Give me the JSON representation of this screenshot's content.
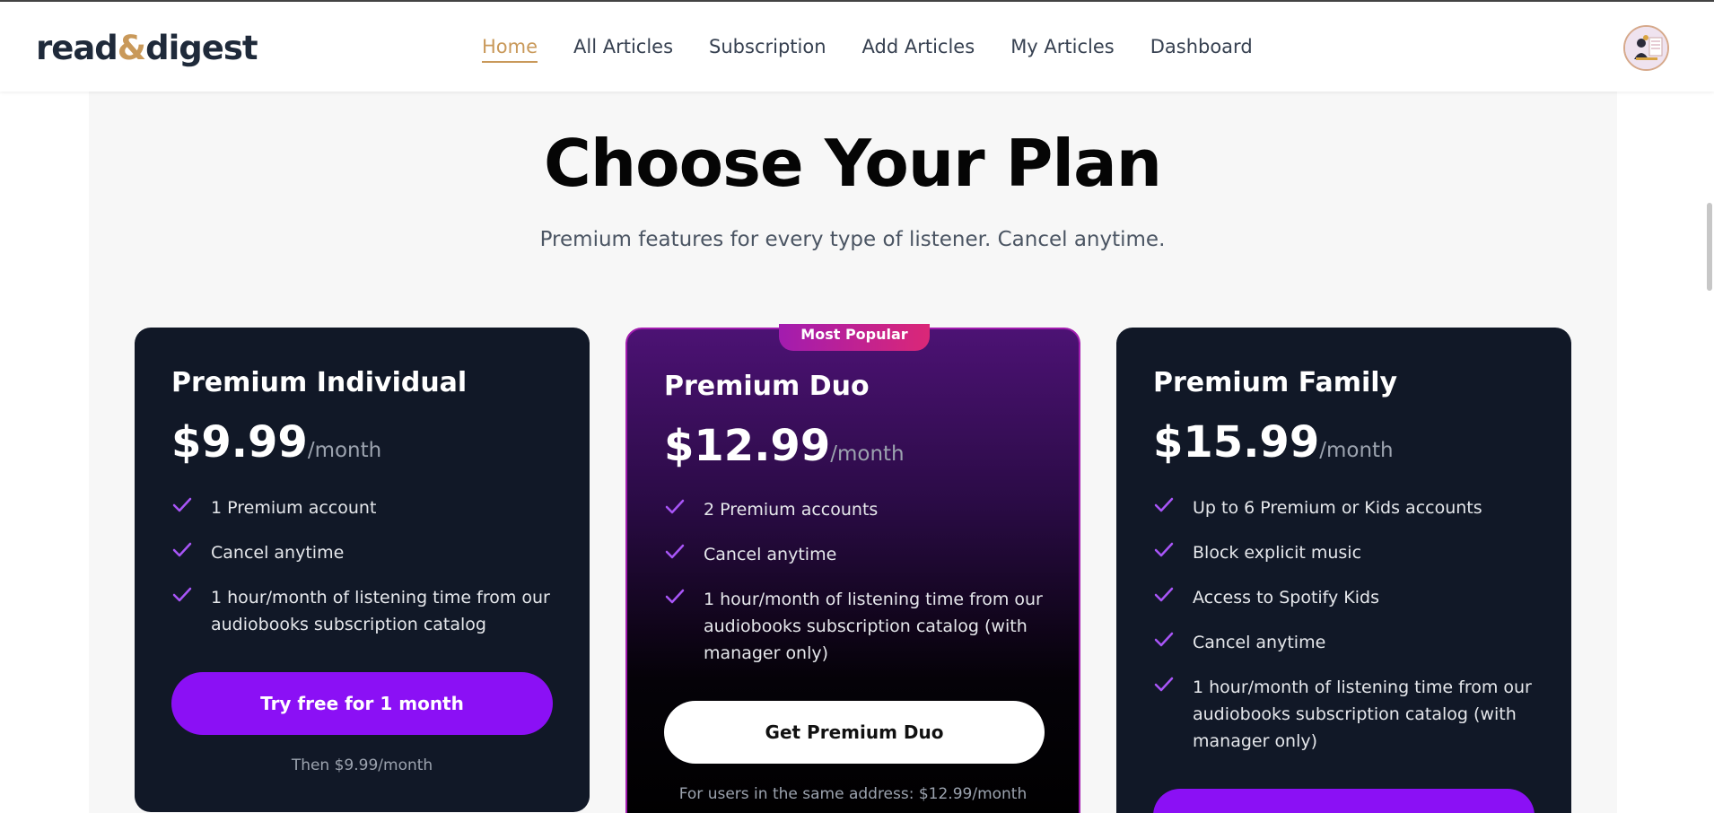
{
  "nav": {
    "logo_prefix": "read",
    "logo_amp": "&",
    "logo_suffix": "digest",
    "links": [
      "Home",
      "All Articles",
      "Subscription",
      "Add Articles",
      "My Articles",
      "Dashboard"
    ],
    "active": "Home"
  },
  "hero": {
    "title": "Choose Your Plan",
    "subtitle": "Premium features for every type of listener. Cancel anytime."
  },
  "plans": [
    {
      "name": "Premium Individual",
      "price": "$9.99",
      "period": "/month",
      "features": [
        "1 Premium account",
        "Cancel anytime",
        "1 hour/month of listening time from our audiobooks subscription catalog"
      ],
      "button": "Try free for 1 month",
      "note": "Then $9.99/month"
    },
    {
      "badge": "Most Popular",
      "name": "Premium Duo",
      "price": "$12.99",
      "period": "/month",
      "features": [
        "2 Premium accounts",
        "Cancel anytime",
        "1 hour/month of listening time from our audiobooks subscription catalog (with manager only)"
      ],
      "button": "Get Premium Duo",
      "note": "For users in the same address: $12.99/month"
    },
    {
      "name": "Premium Family",
      "price": "$15.99",
      "period": "/month",
      "features": [
        "Up to 6 Premium or Kids accounts",
        "Block explicit music",
        "Access to Spotify Kids",
        "Cancel anytime",
        "1 hour/month of listening time from our audiobooks subscription catalog (with manager only)"
      ]
    }
  ],
  "colors": {
    "accent_gold": "#c9995a",
    "button_purple": "#8b10f5",
    "check_purple": "#a855f7",
    "card_dark": "#111827"
  },
  "icons": {
    "check": "check-icon"
  }
}
